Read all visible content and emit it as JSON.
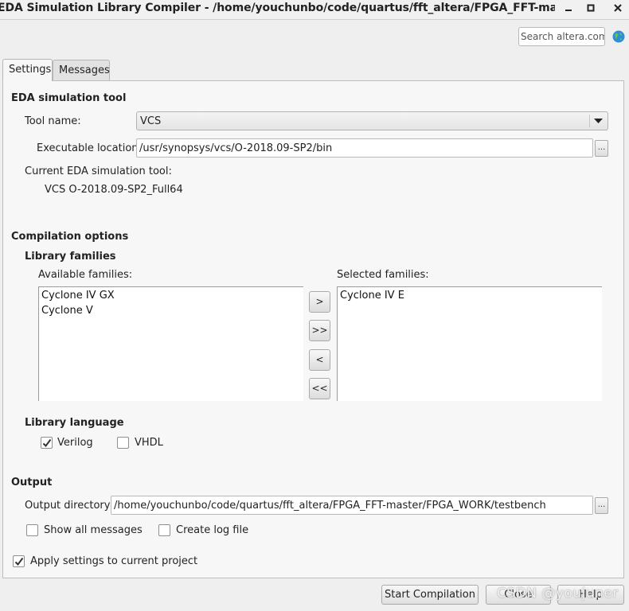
{
  "window": {
    "title": "EDA Simulation Library Compiler - /home/youchunbo/code/quartus/fft_altera/FPGA_FFT-master/FP···",
    "controls": {
      "minimize": "–",
      "maximize": "□",
      "close": "✕"
    }
  },
  "search": {
    "placeholder": "Search altera.com",
    "icon": "globe-icon"
  },
  "tabs": [
    {
      "label": "Settings",
      "active": true
    },
    {
      "label": "Messages",
      "active": false
    }
  ],
  "eda_tool": {
    "section_title": "EDA simulation tool",
    "tool_name_label": "Tool name:",
    "tool_name_value": "VCS",
    "exec_location_label": "Executable location:",
    "exec_location_value": "/usr/synopsys/vcs/O-2018.09-SP2/bin",
    "browse_label": "...",
    "current_tool_label": "Current EDA simulation tool:",
    "current_tool_value": "VCS O-2018.09-SP2_Full64"
  },
  "compilation": {
    "section_title": "Compilation options",
    "library_families_title": "Library families",
    "available_label": "Available families:",
    "available": [
      "Cyclone IV GX",
      "Cyclone V"
    ],
    "selected_label": "Selected families:",
    "selected": [
      "Cyclone IV E"
    ],
    "move_buttons": [
      ">",
      ">>",
      "<",
      "<<"
    ],
    "library_language_title": "Library language",
    "languages": [
      {
        "label": "Verilog",
        "checked": true
      },
      {
        "label": "VHDL",
        "checked": false
      }
    ]
  },
  "output": {
    "section_title": "Output",
    "dir_label": "Output directory:",
    "dir_value": "/home/youchunbo/code/quartus/fft_altera/FPGA_FFT-master/FPGA_WORK/testbench",
    "browse_label": "...",
    "show_all_messages": {
      "label": "Show all messages",
      "checked": false
    },
    "create_log_file": {
      "label": "Create log file",
      "checked": false
    }
  },
  "apply_settings": {
    "label": "Apply settings to current project",
    "checked": true
  },
  "buttons": {
    "start": "Start Compilation",
    "close": "Close",
    "help": "Help"
  },
  "watermark": "CSDN @youjuner",
  "colors": {
    "checkmark": "#333333",
    "globe": "#2f8fd6",
    "panel": "#f7f7f7"
  }
}
